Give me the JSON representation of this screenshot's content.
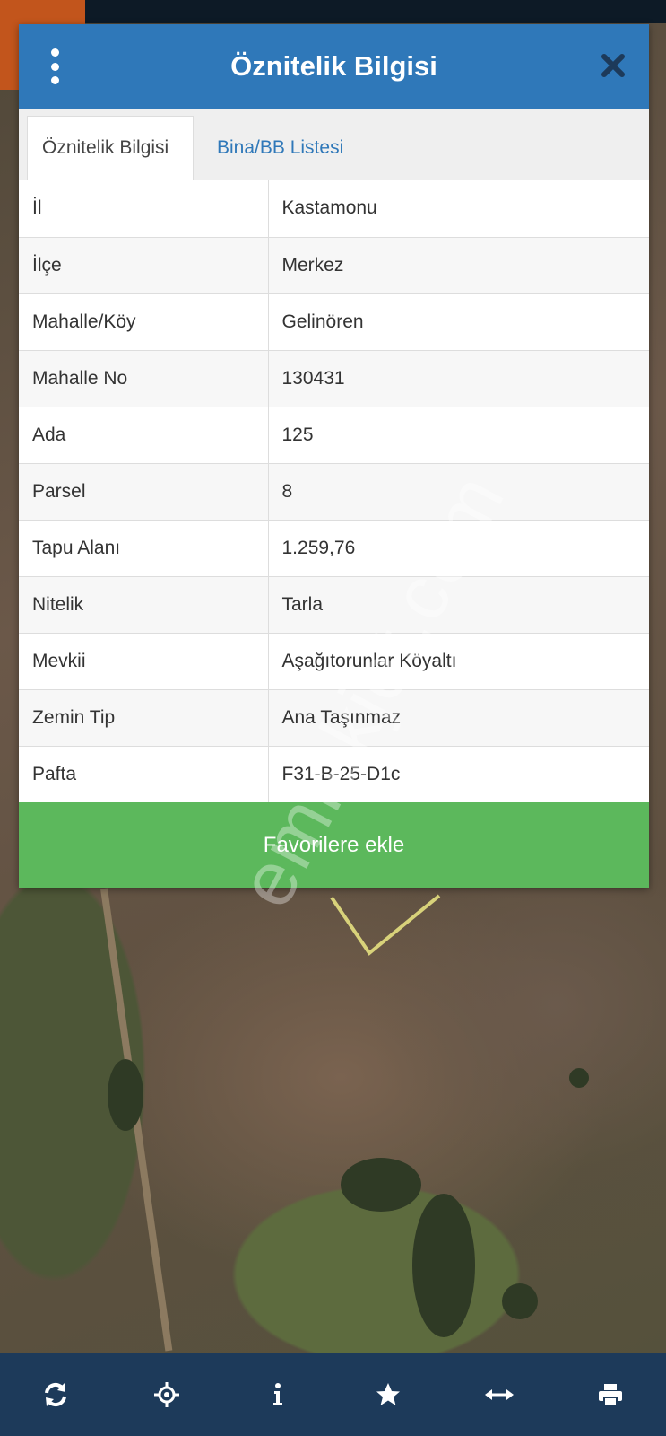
{
  "dialog": {
    "title": "Öznitelik Bilgisi",
    "tabs": [
      {
        "label": "Öznitelik Bilgisi",
        "active": true
      },
      {
        "label": "Bina/BB Listesi",
        "active": false
      }
    ],
    "rows": [
      {
        "key": "İl",
        "value": "Kastamonu"
      },
      {
        "key": "İlçe",
        "value": "Merkez"
      },
      {
        "key": "Mahalle/Köy",
        "value": "Gelinören"
      },
      {
        "key": "Mahalle No",
        "value": "130431"
      },
      {
        "key": "Ada",
        "value": "125"
      },
      {
        "key": "Parsel",
        "value": "8"
      },
      {
        "key": "Tapu Alanı",
        "value": "1.259,76"
      },
      {
        "key": "Nitelik",
        "value": "Tarla"
      },
      {
        "key": "Mevkii",
        "value": "Aşağıtorunlar Köyaltı"
      },
      {
        "key": "Zemin Tip",
        "value": "Ana Taşınmaz"
      },
      {
        "key": "Pafta",
        "value": "F31-B-25-D1c"
      }
    ],
    "favorite_button": "Favorilere ekle"
  },
  "watermark": "emlakjet.com",
  "bottom_toolbar": [
    {
      "icon": "refresh-icon"
    },
    {
      "icon": "crosshair-icon"
    },
    {
      "icon": "info-icon"
    },
    {
      "icon": "star-icon"
    },
    {
      "icon": "measure-icon"
    },
    {
      "icon": "print-icon"
    }
  ],
  "colors": {
    "header_blue": "#2f78b9",
    "favorite_green": "#5cb85c",
    "toolbar_navy": "#1d3a5a"
  }
}
